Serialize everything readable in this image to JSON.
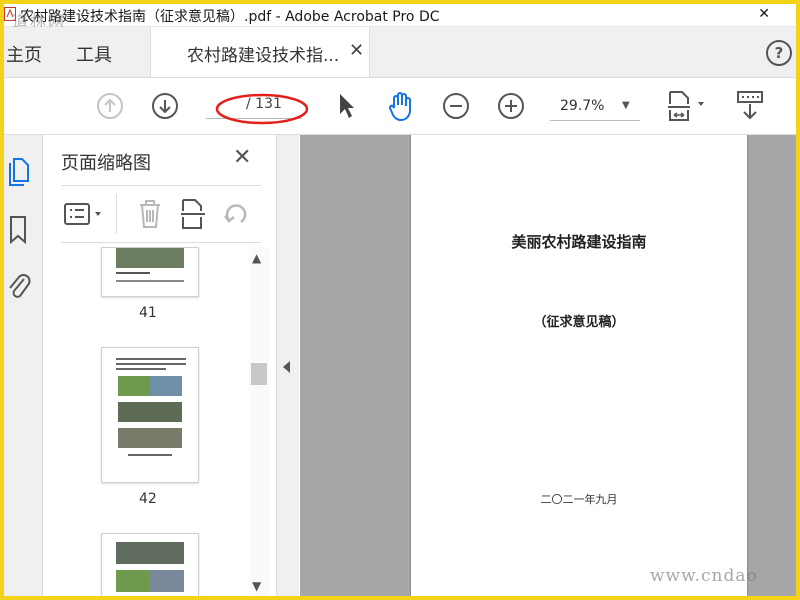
{
  "window": {
    "title": "农村路建设技术指南（征求意见稿）.pdf - Adobe Acrobat Pro DC",
    "close_glyph": "✕"
  },
  "watermarks": {
    "top_left": "道林网",
    "bottom_right": "www.cndao"
  },
  "tabs": {
    "home": "主页",
    "tools": "工具",
    "document": "农村路建设技术指...",
    "close_glyph": "✕",
    "help_glyph": "?"
  },
  "toolbar": {
    "page_current": "",
    "page_total": "/ 131",
    "zoom": "29.7%",
    "zoom_caret": "▼",
    "icons": [
      "page-up-icon",
      "page-down-icon",
      "select-arrow-icon",
      "hand-tool-icon",
      "zoom-out-icon",
      "zoom-in-icon",
      "fit-page-icon",
      "scroll-mode-icon"
    ]
  },
  "annotation": {
    "highlight_color": "#e3201b"
  },
  "panel": {
    "title": "页面缩略图",
    "close_glyph": "✕",
    "thumbnails": [
      {
        "label": "41"
      },
      {
        "label": "42"
      }
    ],
    "scroll_up": "▲",
    "scroll_down": "▼"
  },
  "document": {
    "title": "美丽农村路建设指南",
    "subtitle": "（征求意见稿）",
    "date": "二〇二一年九月"
  },
  "colors": {
    "accent_blue": "#1473e6",
    "frame_yellow": "#f3d21a",
    "canvas_gray": "#a6a6a6"
  }
}
